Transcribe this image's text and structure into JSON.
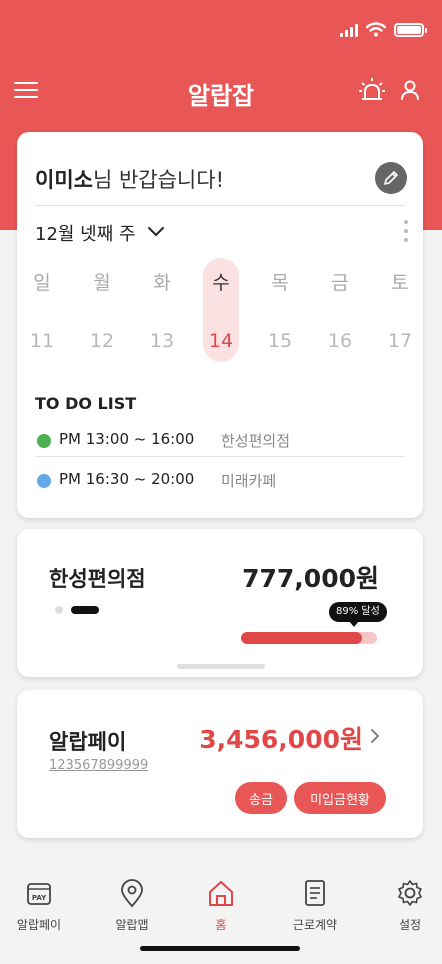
{
  "app": {
    "title": "알랍잡"
  },
  "greeting": {
    "name": "이미소",
    "suffix": "님 반갑습니다!"
  },
  "week": {
    "label": "12월 넷째 주"
  },
  "days": [
    {
      "dow": "일",
      "num": "11",
      "selected": false
    },
    {
      "dow": "월",
      "num": "12",
      "selected": false
    },
    {
      "dow": "화",
      "num": "13",
      "selected": false
    },
    {
      "dow": "수",
      "num": "14",
      "selected": true
    },
    {
      "dow": "목",
      "num": "15",
      "selected": false
    },
    {
      "dow": "금",
      "num": "16",
      "selected": false
    },
    {
      "dow": "토",
      "num": "17",
      "selected": false
    }
  ],
  "todo": {
    "title": "TO DO LIST",
    "items": [
      {
        "time": "PM 13:00 ~ 16:00",
        "place": "한성편의점",
        "dot_color": "#4caf50"
      },
      {
        "time": "PM 16:30 ~ 20:00",
        "place": "미래카페",
        "dot_color": "#64a8e8"
      }
    ]
  },
  "workplace": {
    "name": "한성편의점",
    "amount": "777,000원",
    "progress_label": "89% 달성",
    "progress_percent": 89
  },
  "pay": {
    "title": "알랍페이",
    "account": "123567899999",
    "amount": "3,456,000원",
    "send_label": "송금",
    "unpaid_label": "미입금현황"
  },
  "nav": [
    {
      "label": "알랍페이",
      "icon": "pay-icon",
      "active": false
    },
    {
      "label": "알랍맵",
      "icon": "map-pin-icon",
      "active": false
    },
    {
      "label": "홈",
      "icon": "home-icon",
      "active": true
    },
    {
      "label": "근로계약",
      "icon": "contract-icon",
      "active": false
    },
    {
      "label": "설정",
      "icon": "gear-icon",
      "active": false
    }
  ],
  "colors": {
    "brand": "#e95656",
    "accent": "#e04848",
    "selected_day_bg": "#fbe1e1"
  }
}
